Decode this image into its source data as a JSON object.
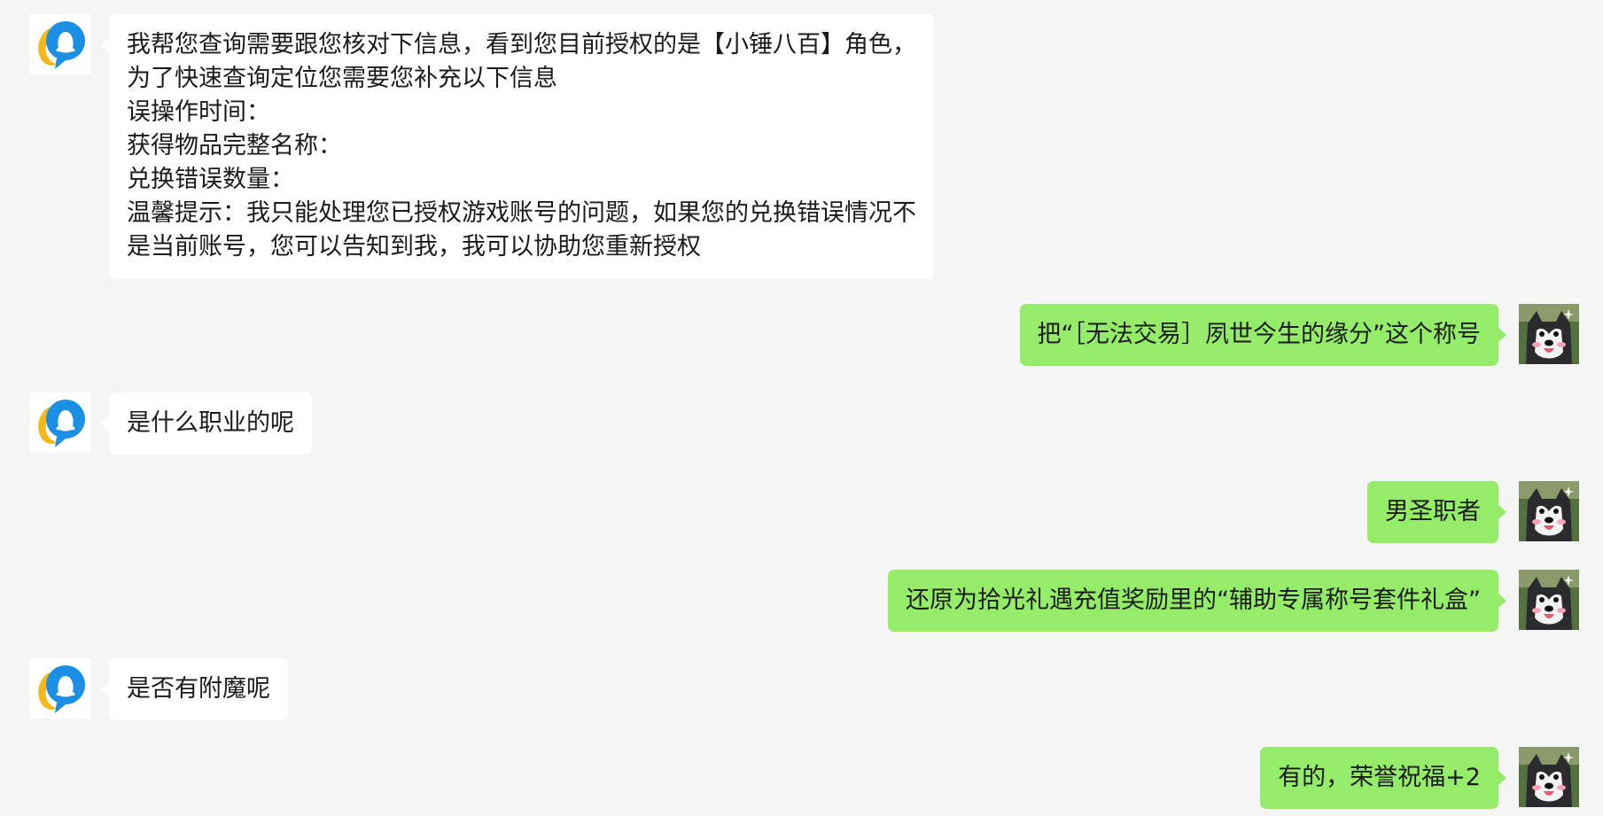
{
  "messages": [
    {
      "sender": "agent",
      "lines": [
        "我帮您查询需要跟您核对下信息，看到您目前授权的是【小锤八百】角色，",
        "为了快速查询定位您需要您补充以下信息",
        "误操作时间：",
        "获得物品完整名称：",
        "兑换错误数量：",
        "温馨提示：我只能处理您已授权游戏账号的问题，如果您的兑换错误情况不",
        "是当前账号，您可以告知到我，我可以协助您重新授权"
      ]
    },
    {
      "sender": "user",
      "text": "把“［无法交易］夙世今生的缘分”这个称号"
    },
    {
      "sender": "agent",
      "text": "是什么职业的呢"
    },
    {
      "sender": "user",
      "text": "男圣职者"
    },
    {
      "sender": "user",
      "text": "还原为拾光礼遇充值奖励里的“辅助专属称号套件礼盒”"
    },
    {
      "sender": "agent",
      "text": "是否有附魔呢"
    },
    {
      "sender": "user",
      "text": "有的，荣誉祝福+2"
    }
  ],
  "avatars": {
    "agent_icon": "qq-service-icon",
    "user_icon": "husky-dog-avatar"
  },
  "colors": {
    "background": "#f5f5f5",
    "agent_bubble": "#ffffff",
    "user_bubble": "#95ec69",
    "text": "#1b1b1b"
  }
}
